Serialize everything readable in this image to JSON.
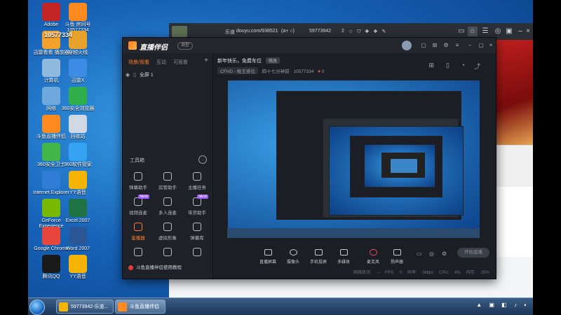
{
  "desktop": {
    "icons": [
      {
        "label": "Adobe",
        "color": "#c32525"
      },
      {
        "label": "斗鱼 房间号 10577334",
        "color": "#ff8a1f"
      },
      {
        "label": "迅雷看看 播放器",
        "color": "#f2a12d"
      },
      {
        "label": "穿越火线",
        "color": "#e6a22a"
      },
      {
        "label": "计算机",
        "color": "#8fb9de"
      },
      {
        "label": "迅雷X",
        "color": "#3c8ce6"
      },
      {
        "label": "网络",
        "color": "#6fa8dc"
      },
      {
        "label": "360安全浏览器",
        "color": "#2fae4b"
      },
      {
        "label": "斗鱼直播伴侣",
        "color": "#ff8a1f"
      },
      {
        "label": "回收站",
        "color": "#cfd8e3"
      },
      {
        "label": "360安全卫士",
        "color": "#43b649"
      },
      {
        "label": "360软件管家",
        "color": "#36a3f2"
      },
      {
        "label": "Internet Explorer",
        "color": "#2f7dd6"
      },
      {
        "label": "YY语音",
        "color": "#f5b400"
      },
      {
        "label": "GeForce Experience",
        "color": "#76b900"
      },
      {
        "label": "Excel 2007",
        "color": "#1f7244"
      },
      {
        "label": "Google Chrome",
        "color": "#e8453c"
      },
      {
        "label": "Word 2007",
        "color": "#2b5797"
      },
      {
        "label": "腾讯QQ",
        "color": "#1a1a1a"
      },
      {
        "label": "YY语音",
        "color": "#f5b400"
      }
    ],
    "room_overlay": "10577334"
  },
  "taskbar": {
    "buttons": [
      {
        "label": "59773942-乐道...",
        "color": "#f5b400"
      },
      {
        "label": "斗鱼直播伴侣",
        "color": "#ff8a1f"
      }
    ],
    "tray": "▲ ▣ ◧ ♪ ◐"
  },
  "browser": {
    "title_prefix": "乐道",
    "url": "douyu.com/938521",
    "tab_text": "(a+ ○)",
    "fans": "59773942",
    "followers": "2",
    "actions": "☆ ⛉ ✚ ❖ ✎",
    "icons": [
      "window-icon",
      "home-icon",
      "list-icon",
      "gamepad-icon",
      "window-icon",
      "minimize-icon",
      "maximize-icon",
      "close-icon"
    ]
  },
  "companion": {
    "app_name": "直播伴侣",
    "badge": "测型",
    "sidebar": {
      "tabs": [
        "场景/观看",
        "互动",
        "可观看"
      ],
      "add_symbol": "+",
      "scene_name": "全屏 1",
      "tools_title": "工具箱",
      "tools": [
        {
          "label": "弹幕助手",
          "new": false,
          "active": false
        },
        {
          "label": "房管助手",
          "new": false,
          "active": false
        },
        {
          "label": "主播任务",
          "new": false,
          "active": false
        },
        {
          "label": "视频连麦",
          "new": true,
          "active": false
        },
        {
          "label": "多人连麦",
          "new": false,
          "active": false
        },
        {
          "label": "带货助手",
          "new": true,
          "active": false
        },
        {
          "label": "鉴播器",
          "new": false,
          "active": true
        },
        {
          "label": "虚拟形象",
          "new": false,
          "active": false
        },
        {
          "label": "弹幕库",
          "new": false,
          "active": false
        },
        {
          "label": "",
          "new": false,
          "active": false
        },
        {
          "label": "",
          "new": false,
          "active": false
        },
        {
          "label": "",
          "new": false,
          "active": false
        }
      ],
      "tip": "斗鱼直播伴侣使用教程"
    },
    "room": {
      "title": "新年快乐，免费车位",
      "edit_label": "修改",
      "category": "CFHD - 枪王排位",
      "meta": "四十七分钟前 · 10577334",
      "likes": "0"
    },
    "bottom": {
      "buttons": [
        "直播屏幕",
        "摄像头",
        "手机投屏",
        "多媒体",
        "麦克风",
        "扬声器"
      ],
      "go_live": "开始直播",
      "status": "网络状况: -- FPS: 0 码率: 0kbps CPU: 4% 内存: 25%"
    }
  }
}
